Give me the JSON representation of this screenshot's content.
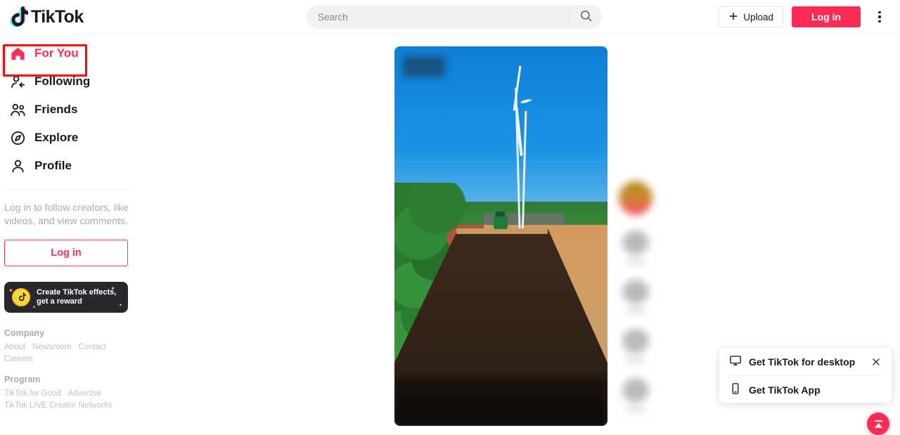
{
  "brand": {
    "name": "TikTok",
    "accent_red": "#fe2c55",
    "accent_cyan": "#25f4ee",
    "highlight_red": "#ff0000"
  },
  "header": {
    "logo_text": "TikTok",
    "logo_icon": "tiktok-note-icon",
    "search": {
      "placeholder": "Search",
      "value": "",
      "icon": "search-icon"
    },
    "upload_label": "Upload",
    "upload_icon": "plus-icon",
    "login_label": "Log in",
    "more_icon": "kebab-menu-icon"
  },
  "sidebar": {
    "items": [
      {
        "label": "For You",
        "icon": "home-icon",
        "active": true
      },
      {
        "label": "Following",
        "icon": "user-plus-icon",
        "active": false
      },
      {
        "label": "Friends",
        "icon": "users-icon",
        "active": false
      },
      {
        "label": "Explore",
        "icon": "compass-icon",
        "active": false
      },
      {
        "label": "Profile",
        "icon": "user-icon",
        "active": false
      }
    ],
    "login_prompt": "Log in to follow creators, like videos, and view comments.",
    "login_button": "Log in",
    "effects_card": {
      "line1": "Create TikTok effects,",
      "line2": "get a reward",
      "icon": "coin-tiktok-icon"
    },
    "footer": {
      "company_heading": "Company",
      "company_links": [
        "About",
        "Newsroom",
        "Contact",
        "Careers"
      ],
      "program_heading": "Program",
      "program_links_row1": [
        "TikTok for Good",
        "Advertise"
      ],
      "program_links_row2": [
        "TikTok LIVE Creator Networks"
      ]
    }
  },
  "feed": {
    "video_description": "Aerial view of a tractor tilling a sandy field beside wind turbines under a blue sky",
    "actions": [
      {
        "icon": "avatar",
        "count": ""
      },
      {
        "icon": "heart-icon",
        "count": ""
      },
      {
        "icon": "comment-icon",
        "count": ""
      },
      {
        "icon": "bookmark-icon",
        "count": ""
      },
      {
        "icon": "share-icon",
        "count": ""
      }
    ]
  },
  "popup": {
    "desktop_label": "Get TikTok for desktop",
    "desktop_icon": "monitor-icon",
    "app_label": "Get TikTok App",
    "app_icon": "phone-icon",
    "close_icon": "close-icon"
  },
  "fab": {
    "icon": "upload-tray-icon"
  }
}
